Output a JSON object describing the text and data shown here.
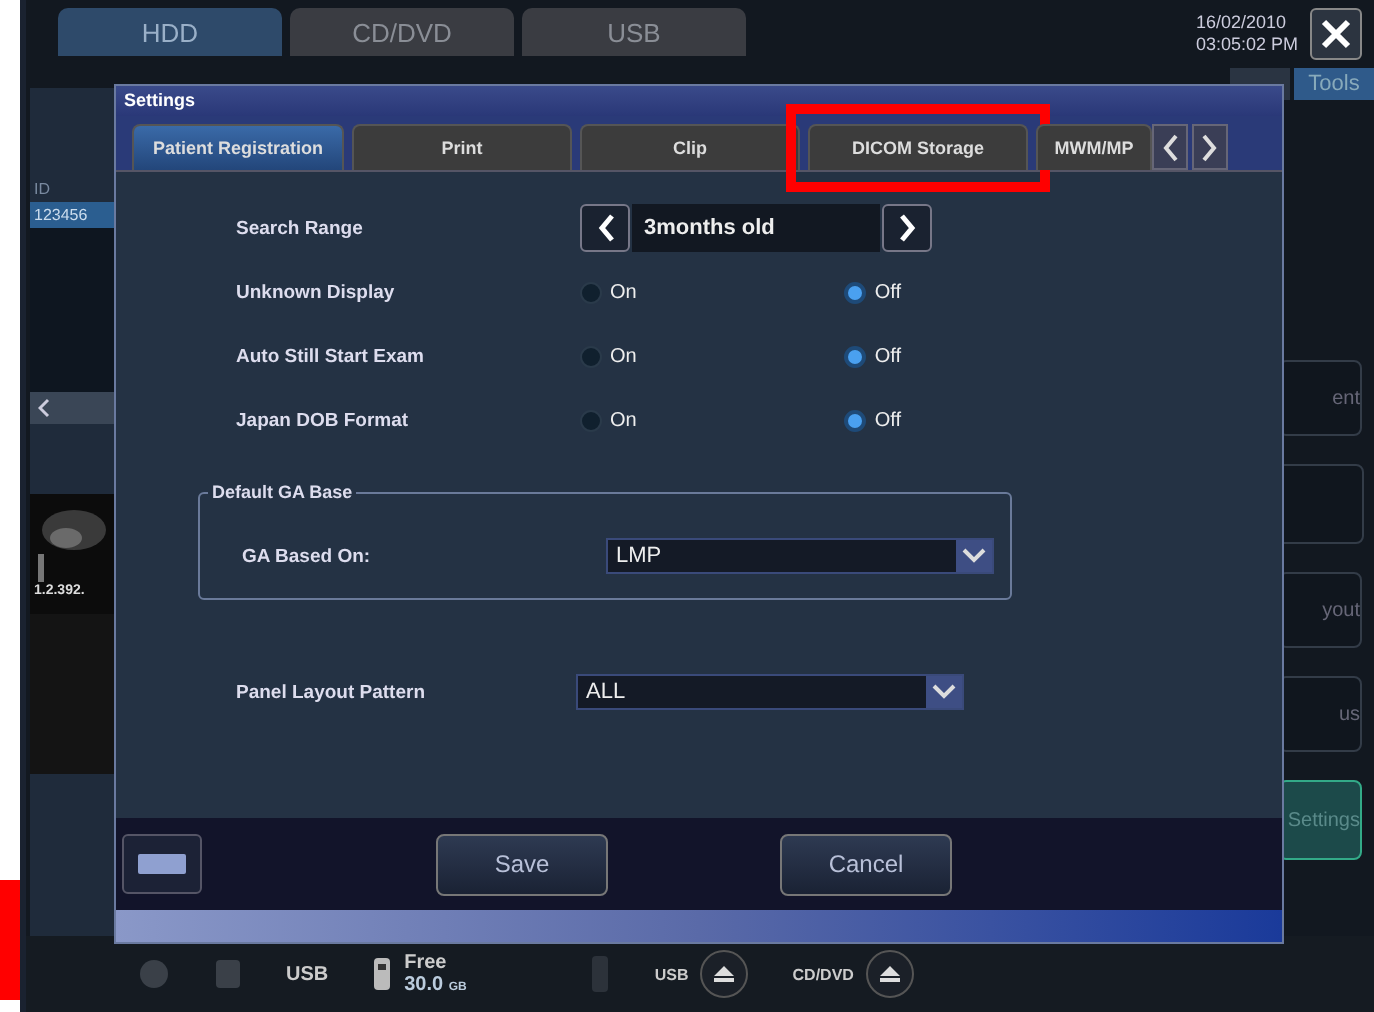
{
  "top_tabs": [
    {
      "label": "HDD",
      "selected": true
    },
    {
      "label": "CD/DVD",
      "selected": false
    },
    {
      "label": "USB",
      "selected": false
    }
  ],
  "date": "16/02/2010",
  "time": "03:05:02 PM",
  "mode_tabs": [
    {
      "label": "Tools",
      "selected": true
    }
  ],
  "patient_list": {
    "header": "ID",
    "rows": [
      {
        "text": "123456",
        "selected": true
      }
    ]
  },
  "image_label": "1.2.392.",
  "side_buttons": [
    {
      "label": "ent",
      "kind": "plain"
    },
    {
      "label": "yout",
      "kind": "plain"
    },
    {
      "label": "us",
      "kind": "plain"
    },
    {
      "label": "Settings",
      "kind": "active"
    }
  ],
  "status_bar": {
    "usb_label": "USB",
    "free_label": "Free",
    "free_value": "30.0",
    "free_unit": "GB",
    "eject": [
      "USB",
      "CD/DVD"
    ]
  },
  "dialog": {
    "title": "Settings",
    "tabs": [
      {
        "label": "Patient Registration",
        "selected": true,
        "highlighted": false
      },
      {
        "label": "Print",
        "selected": false,
        "highlighted": false
      },
      {
        "label": "Clip",
        "selected": false,
        "highlighted": false
      },
      {
        "label": "DICOM Storage",
        "selected": false,
        "highlighted": true
      },
      {
        "label": "MWM/MP",
        "selected": false,
        "highlighted": false
      }
    ],
    "rows": [
      {
        "kind": "stepper",
        "label": "Search Range",
        "value": "3months old"
      },
      {
        "kind": "radio",
        "label": "Unknown Display",
        "options": [
          {
            "label": "On",
            "selected": false
          },
          {
            "label": "Off",
            "selected": true
          }
        ]
      },
      {
        "kind": "radio",
        "label": "Auto Still Start Exam",
        "options": [
          {
            "label": "On",
            "selected": false
          },
          {
            "label": "Off",
            "selected": true
          }
        ]
      },
      {
        "kind": "radio",
        "label": "Japan DOB Format",
        "options": [
          {
            "label": "On",
            "selected": false
          },
          {
            "label": "Off",
            "selected": true
          }
        ]
      }
    ],
    "group": {
      "legend": "Default GA Base",
      "label": "GA Based On:",
      "value": "LMP"
    },
    "panel_layout": {
      "label": "Panel Layout Pattern",
      "value": "ALL"
    },
    "buttons": [
      "Save",
      "Cancel"
    ]
  }
}
